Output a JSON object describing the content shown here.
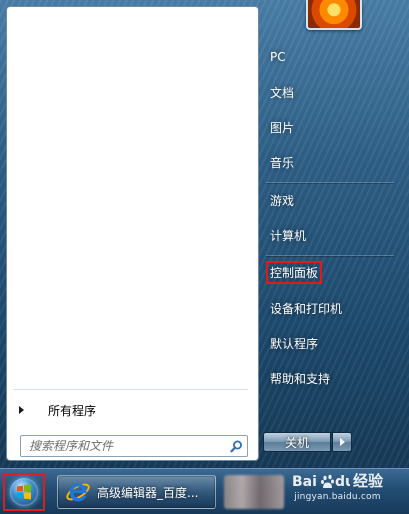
{
  "left": {
    "all_programs": "所有程序",
    "search_placeholder": "搜索程序和文件"
  },
  "right": {
    "items": [
      {
        "label": "PC"
      },
      {
        "label": "文档"
      },
      {
        "label": "图片"
      },
      {
        "label": "音乐"
      },
      {
        "label": "游戏"
      },
      {
        "label": "计算机"
      },
      {
        "label": "控制面板",
        "highlighted": true
      },
      {
        "label": "设备和打印机"
      },
      {
        "label": "默认程序"
      },
      {
        "label": "帮助和支持"
      }
    ],
    "shutdown_label": "关机"
  },
  "taskbar": {
    "ie_label": "高级编辑器_百度..."
  },
  "watermark": {
    "brand_text": "经验",
    "brand_logo": "Bai du",
    "url": "jingyan.baidu.com"
  },
  "colors": {
    "highlight_box": "#e21b1b",
    "ie_blue": "#1e78d6",
    "ie_gold": "#f2b705"
  }
}
